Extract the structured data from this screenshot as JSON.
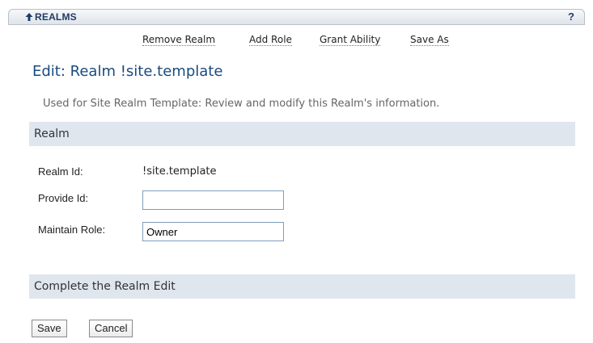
{
  "header": {
    "title": "REALMS",
    "help_label": "?"
  },
  "toolbar": {
    "remove_realm": "Remove Realm",
    "add_role": "Add Role",
    "grant_ability": "Grant Ability",
    "save_as": "Save As"
  },
  "page": {
    "title": "Edit: Realm !site.template",
    "instructions": "Used for Site Realm Template: Review and modify this Realm's information."
  },
  "realm_section": {
    "heading": "Realm",
    "fields": {
      "realm_id": {
        "label": "Realm Id:",
        "value": "!site.template"
      },
      "provide_id": {
        "label": "Provide Id:",
        "value": ""
      },
      "maintain_role": {
        "label": "Maintain Role:",
        "value": "Owner"
      }
    }
  },
  "complete_section": {
    "heading": "Complete the Realm Edit"
  },
  "actions": {
    "save": "Save",
    "cancel": "Cancel"
  },
  "colors": {
    "title_link": "#1f3b66",
    "page_title": "#1a4a80",
    "section_header_bg": "#dfe6ee",
    "input_border": "#7f9db9"
  }
}
